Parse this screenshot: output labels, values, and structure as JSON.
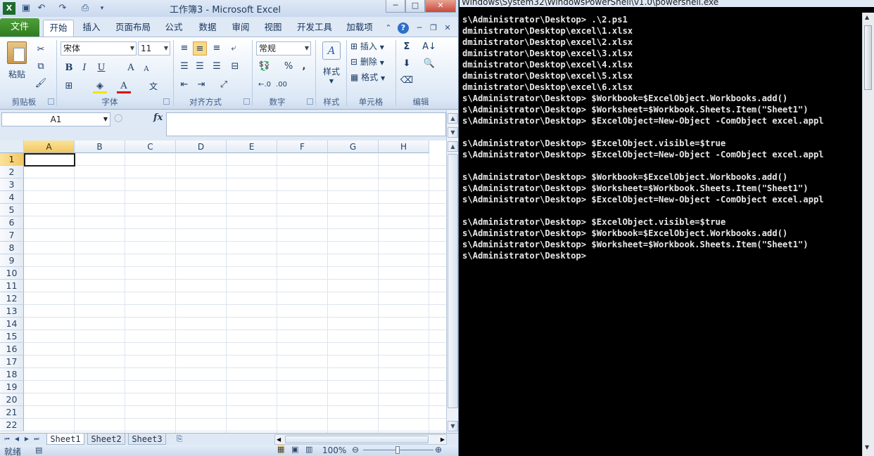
{
  "excel": {
    "window_title": "工作簿3 - Microsoft Excel",
    "quick_access": [
      "save-icon",
      "undo-icon",
      "redo-icon",
      "print-preview-icon",
      "customize-icon"
    ],
    "window_controls": {
      "minimize": "─",
      "restore": "□",
      "close": "✕"
    },
    "tabs": [
      "文件",
      "开始",
      "插入",
      "页面布局",
      "公式",
      "数据",
      "审阅",
      "视图",
      "开发工具",
      "加载项"
    ],
    "active_tab": "开始",
    "ribbon": {
      "clipboard": {
        "label": "剪贴板",
        "paste": "粘贴"
      },
      "font": {
        "label": "字体",
        "font_name": "宋体",
        "font_size": "11",
        "bold": "B",
        "italic": "I",
        "underline": "U",
        "grow": "A",
        "shrink": "A",
        "font_color": "A",
        "phonetic": "文"
      },
      "alignment": {
        "label": "对齐方式"
      },
      "number": {
        "label": "数字",
        "format": "常规",
        "percent": "%",
        "comma": ","
      },
      "styles": {
        "label": "样式",
        "styles_button": "样式"
      },
      "cells": {
        "label": "单元格",
        "insert": "插入",
        "delete": "删除",
        "format": "格式"
      },
      "editing": {
        "label": "编辑",
        "sum": "Σ"
      }
    },
    "formula_bar": {
      "name_box": "A1",
      "fx": "fx",
      "formula": ""
    },
    "columns": [
      "A",
      "B",
      "C",
      "D",
      "E",
      "F",
      "G",
      "H"
    ],
    "rows": [
      "1",
      "2",
      "3",
      "4",
      "5",
      "6",
      "7",
      "8",
      "9",
      "10",
      "11",
      "12",
      "13",
      "14",
      "15",
      "16",
      "17",
      "18",
      "19",
      "20",
      "21",
      "22"
    ],
    "selected_cell": "A1",
    "sheet_tabs": [
      "Sheet1",
      "Sheet2",
      "Sheet3"
    ],
    "active_sheet": "Sheet1",
    "status": {
      "ready": "就绪",
      "zoom": "100%"
    }
  },
  "powershell": {
    "title": "Windows\\System32\\WindowsPowerShell\\v1.0\\powershell.exe",
    "lines": [
      "s\\Administrator\\Desktop> .\\2.ps1",
      "dministrator\\Desktop\\excel\\1.xlsx",
      "dministrator\\Desktop\\excel\\2.xlsx",
      "dministrator\\Desktop\\excel\\3.xlsx",
      "dministrator\\Desktop\\excel\\4.xlsx",
      "dministrator\\Desktop\\excel\\5.xlsx",
      "dministrator\\Desktop\\excel\\6.xlsx",
      "s\\Administrator\\Desktop> $Workbook=$ExcelObject.Workbooks.add()",
      "s\\Administrator\\Desktop> $Worksheet=$Workbook.Sheets.Item(\"Sheet1\")",
      "s\\Administrator\\Desktop> $ExcelObject=New-Object -ComObject excel.appl",
      "",
      "s\\Administrator\\Desktop> $ExcelObject.visible=$true",
      "s\\Administrator\\Desktop> $ExcelObject=New-Object -ComObject excel.appl",
      "",
      "s\\Administrator\\Desktop> $Workbook=$ExcelObject.Workbooks.add()",
      "s\\Administrator\\Desktop> $Worksheet=$Workbook.Sheets.Item(\"Sheet1\")",
      "s\\Administrator\\Desktop> $ExcelObject=New-Object -ComObject excel.appl",
      "",
      "s\\Administrator\\Desktop> $ExcelObject.visible=$true",
      "s\\Administrator\\Desktop> $Workbook=$ExcelObject.Workbooks.add()",
      "s\\Administrator\\Desktop> $Worksheet=$Workbook.Sheets.Item(\"Sheet1\")",
      "s\\Administrator\\Desktop>"
    ]
  }
}
